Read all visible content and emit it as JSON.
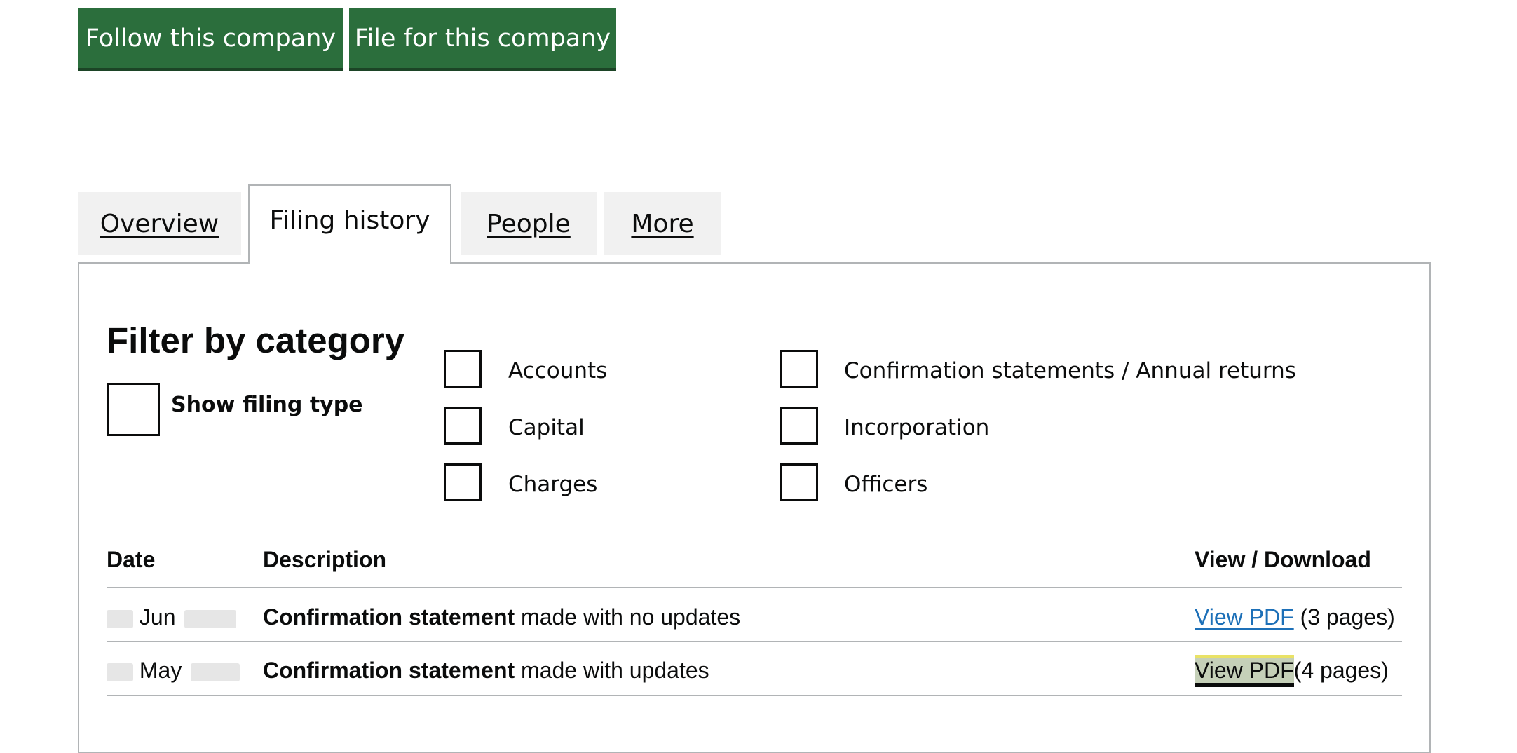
{
  "actions": {
    "follow_label": "Follow this company",
    "file_label": "File for this company"
  },
  "tabs": {
    "overview": "Overview",
    "filing_history": "Filing history",
    "people": "People",
    "more": "More",
    "active": "filing_history"
  },
  "filter": {
    "title": "Filter by category",
    "show_filing_type": "Show filing type",
    "categories": [
      "Accounts",
      "Capital",
      "Charges",
      "Confirmation statements / Annual returns",
      "Incorporation",
      "Officers"
    ]
  },
  "table": {
    "headers": {
      "date": "Date",
      "description": "Description",
      "view": "View / Download"
    },
    "rows": [
      {
        "date_month": "Jun",
        "desc_bold": "Confirmation statement",
        "desc_rest": " made with no updates",
        "link": "View PDF",
        "pages": "(3 pages)"
      },
      {
        "date_month": "May",
        "desc_bold": "Confirmation statement",
        "desc_rest": " made with updates",
        "link": "View PDF",
        "pages": "(4 pages)"
      }
    ]
  },
  "colors": {
    "button_green": "#2b6e3c",
    "link_blue": "#1d70b8",
    "focus_yellow": "#ffdd00",
    "border_grey": "#b1b4b6",
    "tab_grey": "#f1f1f1"
  }
}
